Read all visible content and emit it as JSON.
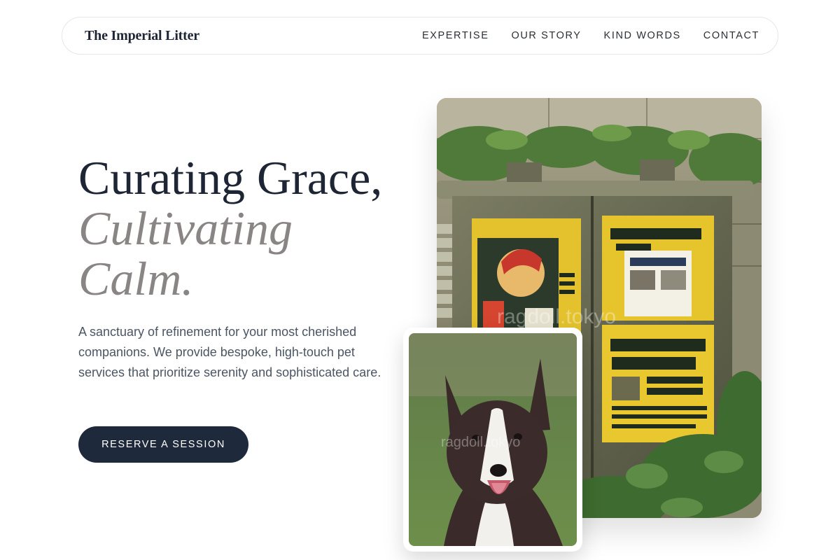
{
  "brand": {
    "name": "The Imperial Litter"
  },
  "nav": {
    "links": [
      "EXPERTISE",
      "OUR STORY",
      "KIND WORDS",
      "CONTACT"
    ]
  },
  "hero": {
    "title_line1": "Curating Grace,",
    "title_line2": "Cultivating",
    "title_line3": "Calm.",
    "description": "A sanctuary of refinement for your most cherished companions. We provide bespoke, high-touch pet services that prioritize serenity and sophisticated care.",
    "cta_label": "RESERVE A SESSION"
  },
  "images": {
    "main_alt": "Colorful posters on an old electrical box with foliage",
    "dog_alt": "Border collie dog smiling",
    "watermark": "ragdoll.tokyo"
  },
  "colors": {
    "primary": "#1e293b",
    "muted_serif": "#8a8585",
    "body_text": "#4b5563"
  }
}
